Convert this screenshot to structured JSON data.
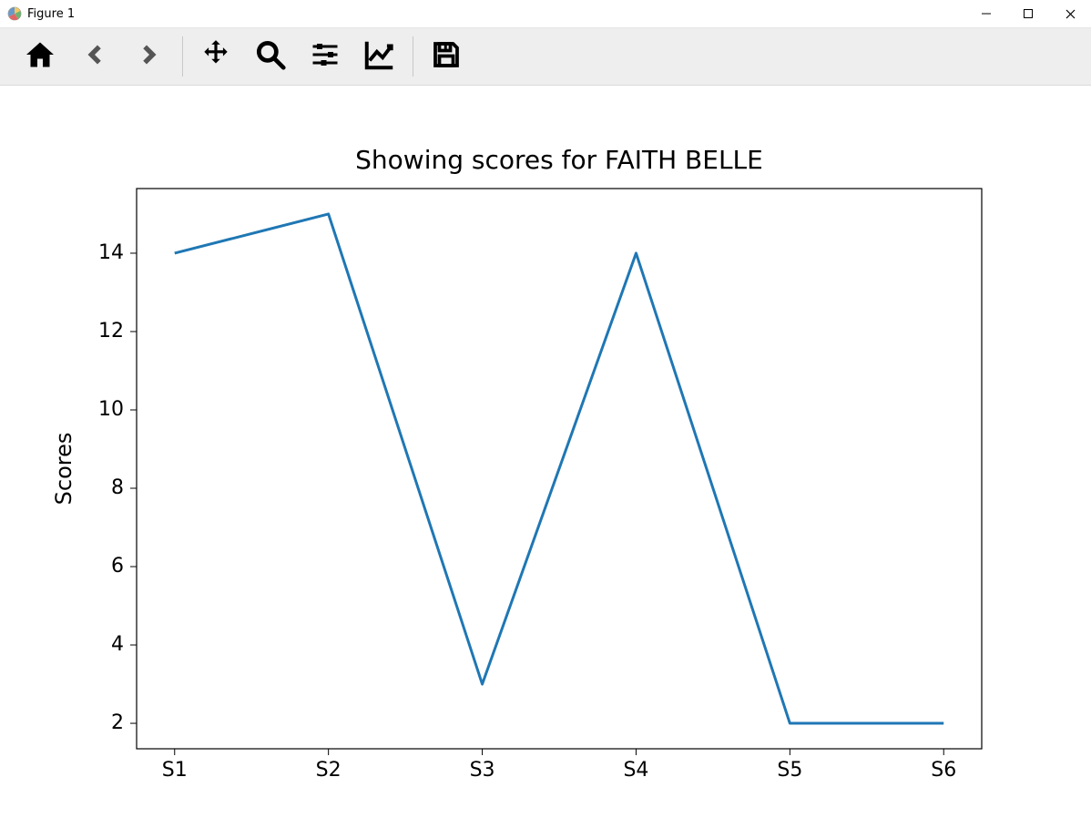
{
  "window": {
    "title": "Figure 1"
  },
  "toolbar": {
    "home": "Home",
    "back": "Back",
    "forward": "Forward",
    "pan": "Pan",
    "zoom": "Zoom",
    "subplots": "Configure subplots",
    "axes": "Edit axis",
    "save": "Save"
  },
  "chart_data": {
    "type": "line",
    "title": "Showing scores for FAITH BELLE",
    "xlabel": "",
    "ylabel": "Scores",
    "categories": [
      "S1",
      "S2",
      "S3",
      "S4",
      "S5",
      "S6"
    ],
    "values": [
      14,
      15,
      3,
      14,
      2,
      2
    ],
    "yticks": [
      2,
      4,
      6,
      8,
      10,
      12,
      14
    ],
    "ylim": [
      1.35,
      15.65
    ],
    "line_color": "#1f77b4"
  }
}
